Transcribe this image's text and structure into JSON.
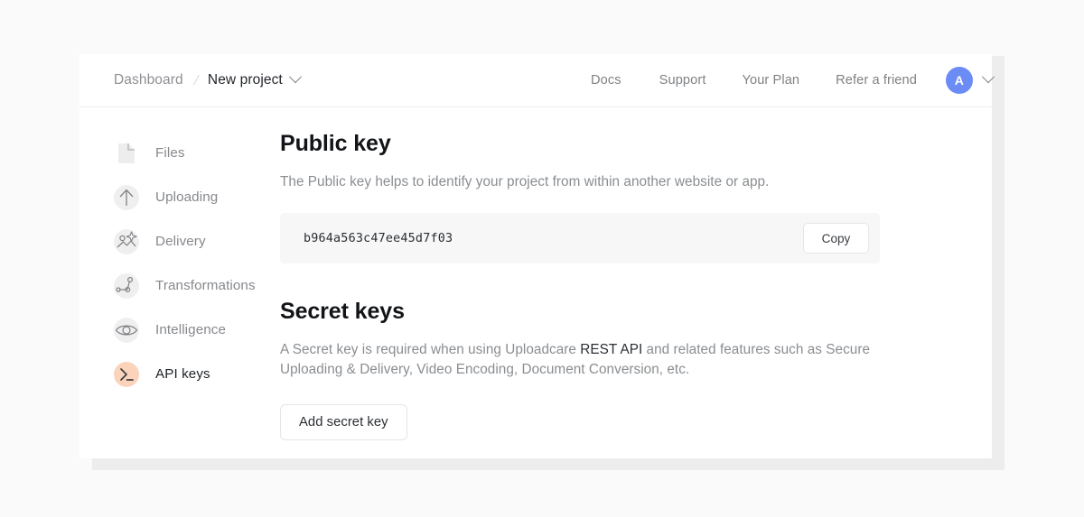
{
  "header": {
    "breadcrumb": {
      "root": "Dashboard",
      "separator": "/",
      "current": "New project",
      "caret_icon": "chevron-down-icon"
    },
    "nav": [
      {
        "label": "Docs"
      },
      {
        "label": "Support"
      },
      {
        "label": "Your Plan"
      },
      {
        "label": "Refer a friend"
      }
    ],
    "account": {
      "avatar_initial": "A",
      "avatar_color": "#6c8cf5",
      "caret_icon": "chevron-down-icon"
    }
  },
  "sidebar": {
    "items": [
      {
        "label": "Files",
        "icon": "file-icon",
        "active": false
      },
      {
        "label": "Uploading",
        "icon": "upload-arrow-icon",
        "active": false
      },
      {
        "label": "Delivery",
        "icon": "image-sparkle-icon",
        "active": false
      },
      {
        "label": "Transformations",
        "icon": "node-graph-icon",
        "active": false
      },
      {
        "label": "Intelligence",
        "icon": "eye-icon",
        "active": false
      },
      {
        "label": "API keys",
        "icon": "terminal-prompt-icon",
        "active": true
      }
    ],
    "active_icon_color": "#fbd3bb",
    "icon_color": "#efefef"
  },
  "main": {
    "public_key": {
      "title": "Public key",
      "description": "The Public key helps to identify your project from within another website or app.",
      "value": "b964a563c47ee45d7f03",
      "copy_label": "Copy"
    },
    "secret_keys": {
      "title": "Secret keys",
      "description_before": "A Secret key is required when using Uploadcare ",
      "link_label": "REST API",
      "description_after": " and related features such as Secure Uploading & Delivery, Video Encoding, Document Conversion, etc.",
      "add_label": "Add secret key"
    }
  }
}
